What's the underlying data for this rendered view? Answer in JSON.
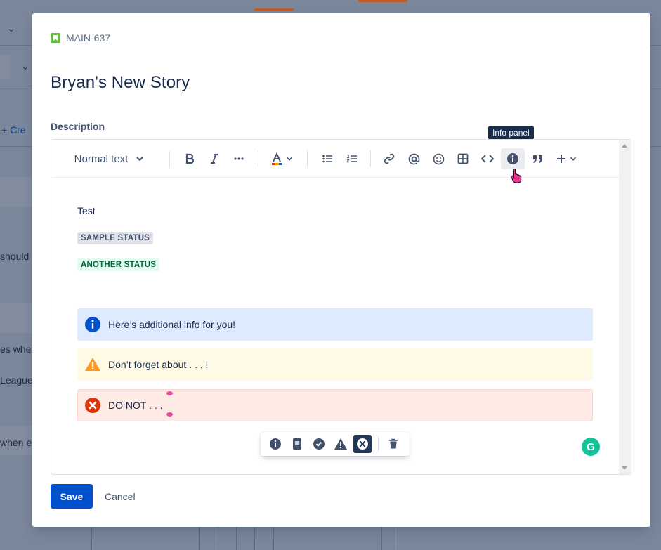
{
  "background": {
    "create_label": "+ Cre",
    "row_texts": [
      "should",
      "es wher",
      "League",
      "when e"
    ]
  },
  "modal": {
    "issue_key": "MAIN-637",
    "issue_type_icon": "story-icon",
    "title": "Bryan's New Story",
    "description_label": "Description",
    "tooltip": "Info panel",
    "toolbar": {
      "text_style": "Normal text",
      "icons": [
        "bold-icon",
        "italic-icon",
        "more-formatting-icon",
        "text-color-icon",
        "bullet-list-icon",
        "numbered-list-icon",
        "link-icon",
        "mention-icon",
        "emoji-icon",
        "table-icon",
        "code-icon",
        "info-panel-icon",
        "quote-icon",
        "insert-plus-icon"
      ]
    },
    "content": {
      "paragraph": "Test",
      "status_1": "SAMPLE STATUS",
      "status_2": "ANOTHER STATUS",
      "panels": [
        {
          "type": "info",
          "text": "Here’s additional info for you!",
          "color": "#0052cc"
        },
        {
          "type": "warning",
          "text": "Don’t forget about . . . !",
          "color": "#ff991f"
        },
        {
          "type": "error",
          "text": "DO NOT  . . .",
          "color": "#de350b"
        }
      ]
    },
    "panel_toolbar": {
      "options": [
        "info-panel-option",
        "note-panel-option",
        "success-panel-option",
        "warning-panel-option",
        "error-panel-option"
      ],
      "selected": "error-panel-option",
      "remove": "delete-icon"
    },
    "grammarly_label": "G",
    "save_label": "Save",
    "cancel_label": "Cancel"
  },
  "colors": {
    "primary": "#0052cc",
    "text": "#172b4d",
    "info_bg": "#deebff",
    "warning_bg": "#fffae6",
    "error_bg": "#ffebe6"
  }
}
